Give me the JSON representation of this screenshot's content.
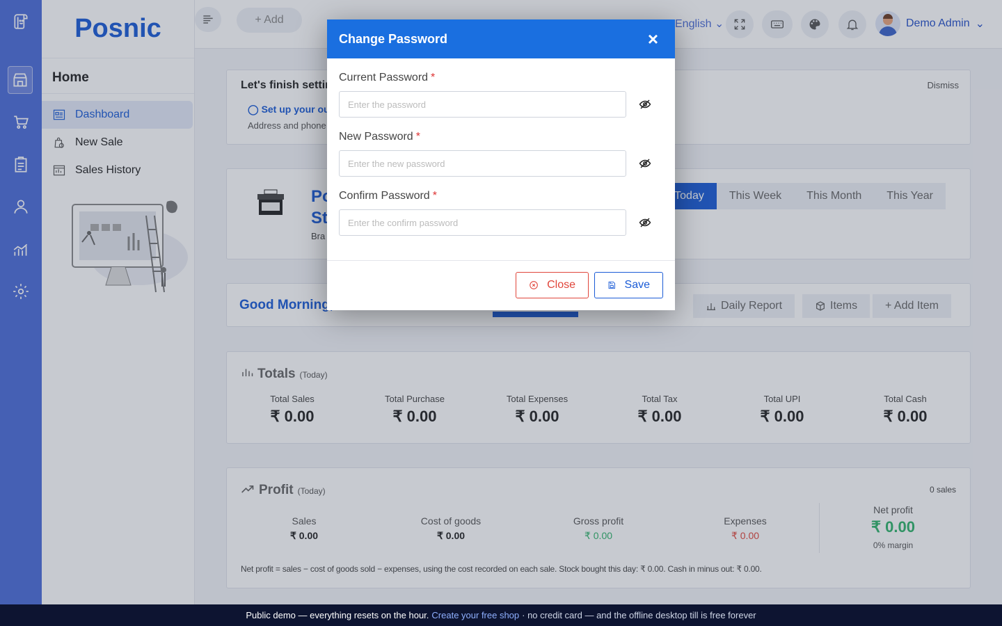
{
  "app": {
    "name": "Posnic"
  },
  "sidebar": {
    "section_title": "Home",
    "items": [
      {
        "label": "Dashboard",
        "icon": "dashboard-icon",
        "active": true
      },
      {
        "label": "New Sale",
        "icon": "new-sale-icon"
      },
      {
        "label": "Sales History",
        "icon": "sales-history-icon"
      }
    ]
  },
  "rail": {
    "icons": [
      "store-icon",
      "cart-icon",
      "clipboard-icon",
      "user-icon",
      "chart-icon",
      "gear-icon"
    ]
  },
  "topbar": {
    "add_label": "+ Add",
    "language": "English",
    "user_name": "Demo Admin"
  },
  "setup_card": {
    "title": "Let's finish setting",
    "dismiss": "Dismiss",
    "step_label": "Set up your out",
    "step_desc": "Address and phone"
  },
  "store_card": {
    "name_line1": "Po",
    "name_line2": "St",
    "branch_prefix": "Bra",
    "store_icon_label": "STORE",
    "period_tabs": [
      "Today",
      "This Week",
      "This Month",
      "This Year"
    ],
    "active_tab": "Today"
  },
  "greeting_card": {
    "greeting": "Good Morning,",
    "actions": [
      "Daily Report",
      "Items",
      "+ Add Item"
    ]
  },
  "totals": {
    "title": "Totals",
    "period": "(Today)",
    "items": [
      {
        "label": "Total Sales",
        "value": "₹ 0.00"
      },
      {
        "label": "Total Purchase",
        "value": "₹ 0.00"
      },
      {
        "label": "Total Expenses",
        "value": "₹ 0.00"
      },
      {
        "label": "Total Tax",
        "value": "₹ 0.00"
      },
      {
        "label": "Total UPI",
        "value": "₹ 0.00"
      },
      {
        "label": "Total Cash",
        "value": "₹ 0.00"
      }
    ]
  },
  "profit": {
    "title": "Profit",
    "period": "(Today)",
    "sales_count": "0 sales",
    "items": [
      {
        "label": "Sales",
        "value": "₹ 0.00",
        "color": "#222222"
      },
      {
        "label": "Cost of goods",
        "value": "₹ 0.00",
        "color": "#222222"
      },
      {
        "label": "Gross profit",
        "value": "₹ 0.00",
        "color": "#2fb36a"
      },
      {
        "label": "Expenses",
        "value": "₹ 0.00",
        "color": "#e0453a"
      }
    ],
    "net_label": "Net profit",
    "net_value": "₹ 0.00",
    "margin": "0% margin",
    "note": "Net profit = sales − cost of goods sold − expenses, using the cost recorded on each sale. Stock bought this day: ₹ 0.00. Cash in minus out: ₹ 0.00."
  },
  "footer": {
    "text_before": "Public demo — everything resets on the hour.",
    "link": "Create your free shop",
    "text_after": "· no credit card — and the offline desktop till is free forever"
  },
  "modal": {
    "title": "Change Password",
    "fields": [
      {
        "label": "Current Password",
        "required_mark": "*",
        "placeholder": "Enter the password"
      },
      {
        "label": "New Password",
        "required_mark": "*",
        "placeholder": "Enter the new password"
      },
      {
        "label": "Confirm Password",
        "required_mark": "*",
        "placeholder": "Enter the confirm password"
      }
    ],
    "close_label": "Close",
    "save_label": "Save"
  },
  "colors": {
    "brand": "#1a5bd6",
    "rail": "#4c6cd8",
    "modal_header": "#1a6fe0",
    "danger": "#e0453a",
    "success": "#2fb36a"
  }
}
